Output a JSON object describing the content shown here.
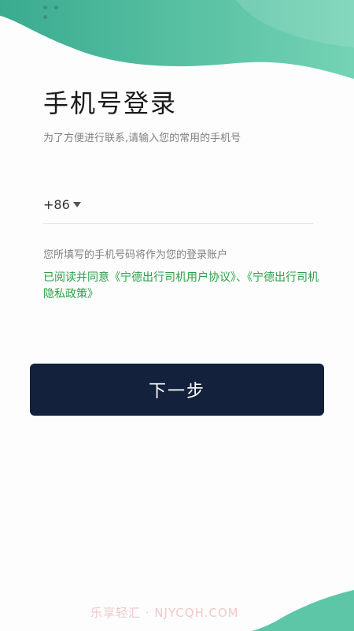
{
  "login": {
    "title": "手机号登录",
    "subtitle": "为了方便进行联系,请输入您的常用的手机号",
    "country_code": "+86",
    "phone_value": "",
    "phone_placeholder": "",
    "hint": "您所填写的手机号码将作为您的登录账户",
    "agreement_prefix": "已阅读并同意",
    "user_agreement": "《宁德出行司机用户协议》",
    "separator": "、",
    "privacy_policy": "《宁德出行司机隐私政策》",
    "next_label": "下一步"
  },
  "watermark": "乐享轻汇 · NJYCQH.COM",
  "colors": {
    "accent_green": "#2aa048",
    "button_bg": "#14213d",
    "wave_teal": "#5cc6a6"
  },
  "icons": {
    "country_dropdown": "caret-down-icon"
  }
}
